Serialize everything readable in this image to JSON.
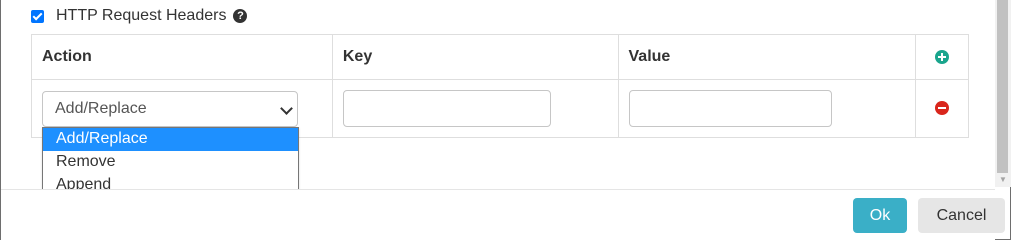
{
  "header": {
    "checkbox_checked": true,
    "label": "HTTP Request Headers",
    "help_icon": "question-circle-icon"
  },
  "table": {
    "columns": [
      "Action",
      "Key",
      "Value"
    ],
    "add_icon": "plus-circle-icon",
    "rows": [
      {
        "action": "Add/Replace",
        "key": "",
        "value": "",
        "remove_icon": "minus-circle-icon"
      }
    ]
  },
  "dropdown": {
    "options": [
      "Add/Replace",
      "Remove",
      "Append"
    ],
    "selected": "Add/Replace"
  },
  "footer": {
    "ok_label": "Ok",
    "cancel_label": "Cancel"
  },
  "colors": {
    "ok": "#3aafc7",
    "add": "#1aa58d",
    "remove": "#d9261c",
    "highlight": "#1e90ff"
  }
}
